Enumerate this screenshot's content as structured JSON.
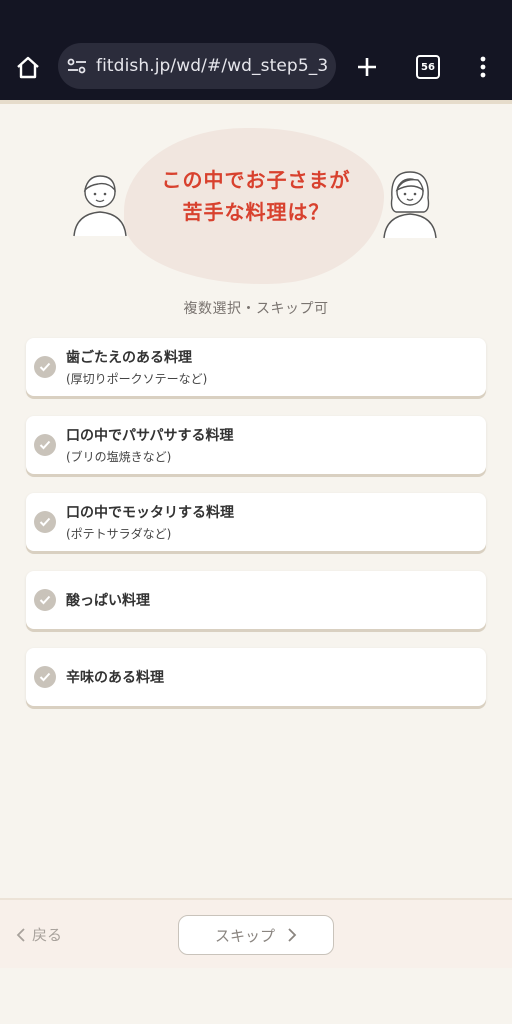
{
  "browser": {
    "url": "fitdish.jp/wd/#/wd_step5_3",
    "tab_count": "56",
    "icons": [
      "home-icon",
      "site-settings-icon",
      "new-tab-icon",
      "tab-switcher-icon",
      "more-menu-icon"
    ]
  },
  "hero": {
    "question_line1": "この中でお子さまが",
    "question_line2": "苦手な料理は？"
  },
  "hint": "複数選択・スキップ可",
  "options": [
    {
      "title": "歯ごたえのある料理",
      "sub": "(厚切りポークソテーなど)"
    },
    {
      "title": "口の中でパサパサする料理",
      "sub": "(ブリの塩焼きなど)"
    },
    {
      "title": "口の中でモッタリする料理",
      "sub": "(ポテトサラダなど)"
    },
    {
      "title": "酸っぱい料理",
      "sub": ""
    },
    {
      "title": "辛味のある料理",
      "sub": ""
    }
  ],
  "footer": {
    "back_label": "戻る",
    "skip_label": "スキップ"
  },
  "colors": {
    "accent_red": "#d8412e",
    "background": "#f7f4ee",
    "check_gray": "#c9c3ba",
    "chrome_dark": "#141523"
  }
}
